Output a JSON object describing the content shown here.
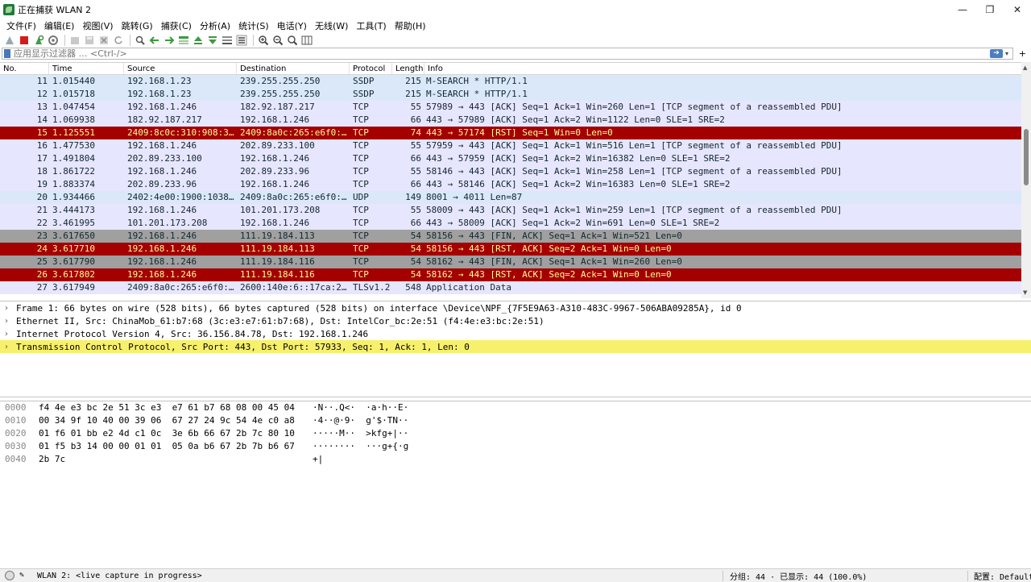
{
  "window": {
    "title": "正在捕获 WLAN 2",
    "minimize_glyph": "—",
    "maximize_glyph": "❐",
    "close_glyph": "✕"
  },
  "menu": [
    {
      "label": "文件(F)"
    },
    {
      "label": "编辑(E)"
    },
    {
      "label": "视图(V)"
    },
    {
      "label": "跳转(G)"
    },
    {
      "label": "捕获(C)"
    },
    {
      "label": "分析(A)"
    },
    {
      "label": "统计(S)"
    },
    {
      "label": "电话(Y)"
    },
    {
      "label": "无线(W)"
    },
    {
      "label": "工具(T)"
    },
    {
      "label": "帮助(H)"
    }
  ],
  "toolbar": {
    "icons": [
      "shark-fin-start-icon",
      "stop-capture-icon",
      "restart-capture-icon",
      "capture-options-icon",
      "open-file-icon",
      "save-file-icon",
      "close-file-icon",
      "reload-icon",
      "find-packet-icon",
      "go-back-icon",
      "go-forward-icon",
      "go-to-packet-icon",
      "go-first-icon",
      "go-last-icon",
      "auto-scroll-icon",
      "colorize-icon",
      "zoom-in-icon",
      "zoom-out-icon",
      "zoom-normal-icon",
      "resize-columns-icon"
    ]
  },
  "filter": {
    "placeholder": "应用显示过滤器 … <Ctrl-/>",
    "plus": "+"
  },
  "packet_list": {
    "columns": {
      "no": "No.",
      "time": "Time",
      "source": "Source",
      "destination": "Destination",
      "protocol": "Protocol",
      "length": "Length",
      "info": "Info"
    },
    "rows": [
      {
        "no": "11",
        "time": "1.015440",
        "source": "192.168.1.23",
        "destination": "239.255.255.250",
        "protocol": "SSDP",
        "length": "215",
        "info": "M-SEARCH * HTTP/1.1",
        "color": "blue"
      },
      {
        "no": "12",
        "time": "1.015718",
        "source": "192.168.1.23",
        "destination": "239.255.255.250",
        "protocol": "SSDP",
        "length": "215",
        "info": "M-SEARCH * HTTP/1.1",
        "color": "blue"
      },
      {
        "no": "13",
        "time": "1.047454",
        "source": "192.168.1.246",
        "destination": "182.92.187.217",
        "protocol": "TCP",
        "length": "55",
        "info": "57989 → 443 [ACK] Seq=1 Ack=1 Win=260 Len=1 [TCP segment of a reassembled PDU]",
        "color": "lav"
      },
      {
        "no": "14",
        "time": "1.069938",
        "source": "182.92.187.217",
        "destination": "192.168.1.246",
        "protocol": "TCP",
        "length": "66",
        "info": "443 → 57989 [ACK] Seq=1 Ack=2 Win=1122 Len=0 SLE=1 SRE=2",
        "color": "lav"
      },
      {
        "no": "15",
        "time": "1.125551",
        "source": "2409:8c0c:310:908:3…",
        "destination": "2409:8a0c:265:e6f0:…",
        "protocol": "TCP",
        "length": "74",
        "info": "443 → 57174 [RST] Seq=1 Win=0 Len=0",
        "color": "red"
      },
      {
        "no": "16",
        "time": "1.477530",
        "source": "192.168.1.246",
        "destination": "202.89.233.100",
        "protocol": "TCP",
        "length": "55",
        "info": "57959 → 443 [ACK] Seq=1 Ack=1 Win=516 Len=1 [TCP segment of a reassembled PDU]",
        "color": "lav"
      },
      {
        "no": "17",
        "time": "1.491804",
        "source": "202.89.233.100",
        "destination": "192.168.1.246",
        "protocol": "TCP",
        "length": "66",
        "info": "443 → 57959 [ACK] Seq=1 Ack=2 Win=16382 Len=0 SLE=1 SRE=2",
        "color": "lav"
      },
      {
        "no": "18",
        "time": "1.861722",
        "source": "192.168.1.246",
        "destination": "202.89.233.96",
        "protocol": "TCP",
        "length": "55",
        "info": "58146 → 443 [ACK] Seq=1 Ack=1 Win=258 Len=1 [TCP segment of a reassembled PDU]",
        "color": "lav"
      },
      {
        "no": "19",
        "time": "1.883374",
        "source": "202.89.233.96",
        "destination": "192.168.1.246",
        "protocol": "TCP",
        "length": "66",
        "info": "443 → 58146 [ACK] Seq=1 Ack=2 Win=16383 Len=0 SLE=1 SRE=2",
        "color": "lav"
      },
      {
        "no": "20",
        "time": "1.934466",
        "source": "2402:4e00:1900:1038…",
        "destination": "2409:8a0c:265:e6f0:…",
        "protocol": "UDP",
        "length": "149",
        "info": "8001 → 4011 Len=87",
        "color": "blue"
      },
      {
        "no": "21",
        "time": "3.444173",
        "source": "192.168.1.246",
        "destination": "101.201.173.208",
        "protocol": "TCP",
        "length": "55",
        "info": "58009 → 443 [ACK] Seq=1 Ack=1 Win=259 Len=1 [TCP segment of a reassembled PDU]",
        "color": "lav"
      },
      {
        "no": "22",
        "time": "3.461995",
        "source": "101.201.173.208",
        "destination": "192.168.1.246",
        "protocol": "TCP",
        "length": "66",
        "info": "443 → 58009 [ACK] Seq=1 Ack=2 Win=691 Len=0 SLE=1 SRE=2",
        "color": "lav"
      },
      {
        "no": "23",
        "time": "3.617650",
        "source": "192.168.1.246",
        "destination": "111.19.184.113",
        "protocol": "TCP",
        "length": "54",
        "info": "58156 → 443 [FIN, ACK] Seq=1 Ack=1 Win=521 Len=0",
        "color": "gray"
      },
      {
        "no": "24",
        "time": "3.617710",
        "source": "192.168.1.246",
        "destination": "111.19.184.113",
        "protocol": "TCP",
        "length": "54",
        "info": "58156 → 443 [RST, ACK] Seq=2 Ack=1 Win=0 Len=0",
        "color": "red"
      },
      {
        "no": "25",
        "time": "3.617790",
        "source": "192.168.1.246",
        "destination": "111.19.184.116",
        "protocol": "TCP",
        "length": "54",
        "info": "58162 → 443 [FIN, ACK] Seq=1 Ack=1 Win=260 Len=0",
        "color": "gray"
      },
      {
        "no": "26",
        "time": "3.617802",
        "source": "192.168.1.246",
        "destination": "111.19.184.116",
        "protocol": "TCP",
        "length": "54",
        "info": "58162 → 443 [RST, ACK] Seq=2 Ack=1 Win=0 Len=0",
        "color": "red"
      },
      {
        "no": "27",
        "time": "3.617949",
        "source": "2409:8a0c:265:e6f0:…",
        "destination": "2600:140e:6::17ca:2…",
        "protocol": "TLSv1.2",
        "length": "548",
        "info": "Application Data",
        "color": "lav"
      }
    ]
  },
  "details": [
    {
      "text": "Frame 1: 66 bytes on wire (528 bits), 66 bytes captured (528 bits) on interface \\Device\\NPF_{7F5E9A63-A310-483C-9967-506ABA09285A}, id 0",
      "selected": false
    },
    {
      "text": "Ethernet II, Src: ChinaMob_61:b7:68 (3c:e3:e7:61:b7:68), Dst: IntelCor_bc:2e:51 (f4:4e:e3:bc:2e:51)",
      "selected": false
    },
    {
      "text": "Internet Protocol Version 4, Src: 36.156.84.78, Dst: 192.168.1.246",
      "selected": false
    },
    {
      "text": "Transmission Control Protocol, Src Port: 443, Dst Port: 57933, Seq: 1, Ack: 1, Len: 0",
      "selected": true
    }
  ],
  "bytes": [
    {
      "offset": "0000",
      "hex": "f4 4e e3 bc 2e 51 3c e3  e7 61 b7 68 08 00 45 04",
      "ascii": "·N··.Q<·  ·a·h··E·"
    },
    {
      "offset": "0010",
      "hex": "00 34 9f 10 40 00 39 06  67 27 24 9c 54 4e c0 a8",
      "ascii": "·4··@·9·  g'$·TN··"
    },
    {
      "offset": "0020",
      "hex": "01 f6 01 bb e2 4d c1 0c  3e 6b 66 67 2b 7c 80 10",
      "ascii": "·····M··  >kfg+|··"
    },
    {
      "offset": "0030",
      "hex": "01 f5 b3 14 00 00 01 01  05 0a b6 67 2b 7b b6 67",
      "ascii": "········  ···g+{·g"
    },
    {
      "offset": "0040",
      "hex": "2b 7c",
      "ascii": "+|"
    }
  ],
  "status": {
    "interface": "WLAN 2: <live capture in progress>",
    "packets": "分组: 44 · 已显示: 44 (100.0%)",
    "profile": "配置: Default"
  }
}
